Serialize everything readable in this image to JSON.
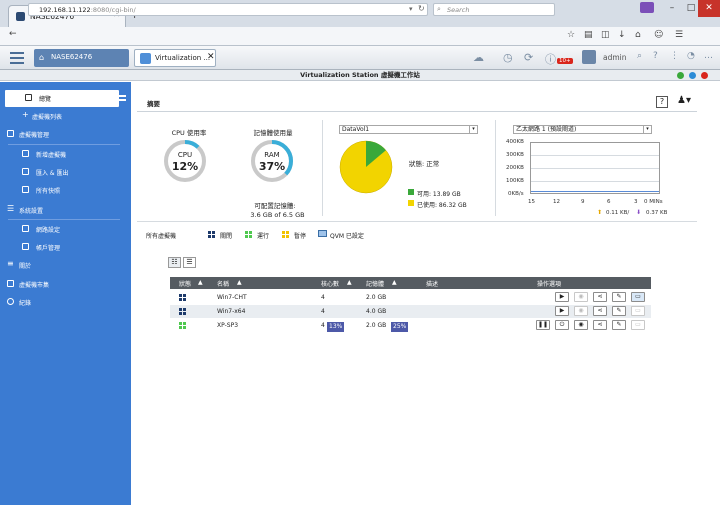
{
  "browser": {
    "tab_title": "NASE62476",
    "url_host": "192.168.11.122",
    "url_rest": ":8080/cgi-bin/",
    "search_placeholder": "Search"
  },
  "qts": {
    "home_label": "NASE62476",
    "app_tab_label": "Virtualization ...",
    "notification_badge": "10+",
    "username": "admin"
  },
  "app": {
    "title": "Virtualization Station 虛擬機工作站"
  },
  "sidebar": {
    "items": [
      {
        "label": "總覽",
        "selected": true
      },
      {
        "label": "虛擬機列表"
      },
      {
        "label": "虛擬機管理"
      },
      {
        "label": "新增虛擬機"
      },
      {
        "label": "匯入 & 匯出"
      },
      {
        "label": "所有快照"
      },
      {
        "label": "系統設置"
      },
      {
        "label": "網路設定"
      },
      {
        "label": "帳戶管理"
      },
      {
        "label": "關於"
      },
      {
        "label": "虛擬機市集"
      },
      {
        "label": "紀錄"
      }
    ]
  },
  "main": {
    "section_title": "摘要",
    "cpu": {
      "caption": "CPU 使用率",
      "label": "CPU",
      "value": "12%",
      "percent": 12
    },
    "ram": {
      "caption": "記憶體使用量",
      "label": "RAM",
      "value": "37%",
      "percent": 37,
      "avail_label": "可配置記憶體:",
      "avail_value": "3.6 GB of 6.5 GB"
    },
    "storage": {
      "volume": "DataVol1",
      "status_label": "狀態:",
      "status_value": "正常",
      "free_label": "可用: 13.89 GB",
      "used_label": "已使用: 86.32 GB",
      "free_color": "#3aa83a",
      "used_color": "#f2d400"
    },
    "network": {
      "adapter": "乙太網路 1 (預設閘道)",
      "y_ticks": [
        "400KB",
        "300KB",
        "200KB",
        "100KB",
        "0KB/s"
      ],
      "x_ticks": [
        "15",
        "12",
        "9",
        "6",
        "3",
        "0 MINs"
      ],
      "up_rate": "0.11 KB/",
      "down_rate": "0.37 KB"
    },
    "vm_filter": {
      "all_label": "所有虛擬機",
      "legend": [
        {
          "label": "關閉",
          "color": "#1d3a6b"
        },
        {
          "label": "運行",
          "color": "#4fc84f"
        },
        {
          "label": "暫停",
          "color": "#f2c300"
        },
        {
          "label": "QVM 已設定",
          "color": "#3a6ea5"
        }
      ]
    },
    "table": {
      "headers": [
        "狀態",
        "名稱",
        "核心數",
        "記憶體",
        "描述",
        "操作選項"
      ],
      "rows": [
        {
          "state": "off",
          "name": "Win7-CHT",
          "cores": "4",
          "memory": "2.0 GB",
          "desc": ""
        },
        {
          "state": "off",
          "name": "Win7-x64",
          "cores": "4",
          "memory": "4.0 GB",
          "desc": ""
        },
        {
          "state": "running",
          "name": "XP-SP3",
          "cores": "4",
          "cpu_usage": "13%",
          "memory": "2.0 GB",
          "mem_usage": "25%",
          "desc": ""
        }
      ]
    }
  }
}
